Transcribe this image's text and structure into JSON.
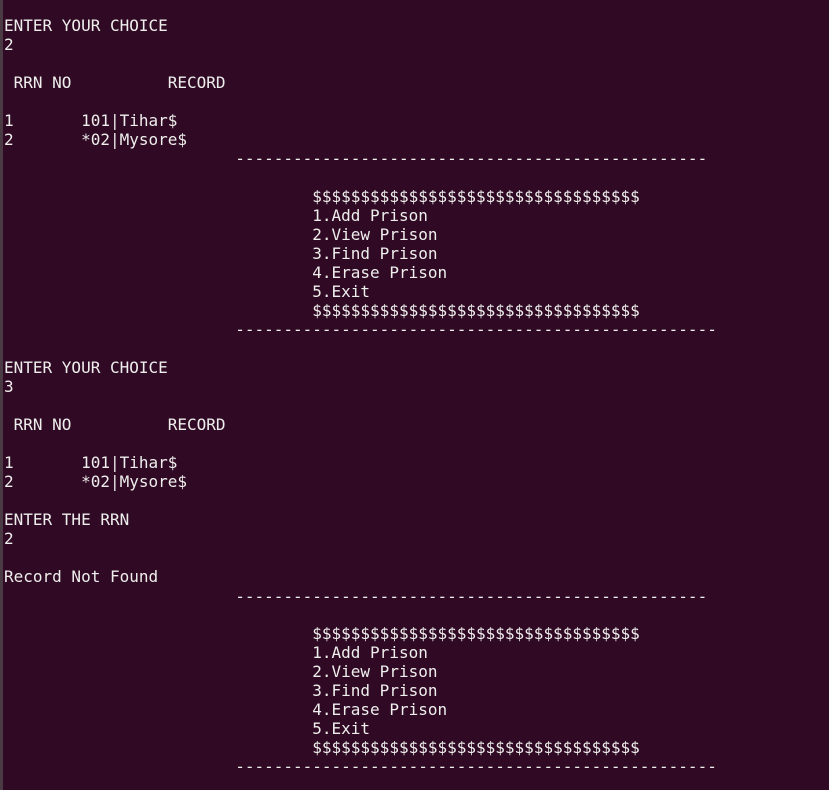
{
  "terminal": {
    "lines": [
      "ENTER YOUR CHOICE",
      "2",
      "",
      " RRN NO          RECORD",
      "",
      "1       101|Tihar$",
      "2       *02|Mysore$",
      "                        -------------------------------------------------",
      "",
      "                                $$$$$$$$$$$$$$$$$$$$$$$$$$$$$$$$$$",
      "                                1.Add Prison",
      "                                2.View Prison",
      "                                3.Find Prison",
      "                                4.Erase Prison",
      "                                5.Exit",
      "                                $$$$$$$$$$$$$$$$$$$$$$$$$$$$$$$$$$",
      "                        --------------------------------------------------",
      "",
      "ENTER YOUR CHOICE",
      "3",
      "",
      " RRN NO          RECORD",
      "",
      "1       101|Tihar$",
      "2       *02|Mysore$",
      "",
      "ENTER THE RRN",
      "2",
      "",
      "Record Not Found",
      "                        -------------------------------------------------",
      "",
      "                                $$$$$$$$$$$$$$$$$$$$$$$$$$$$$$$$$$",
      "                                1.Add Prison",
      "                                2.View Prison",
      "                                3.Find Prison",
      "                                4.Erase Prison",
      "                                5.Exit",
      "                                $$$$$$$$$$$$$$$$$$$$$$$$$$$$$$$$$$",
      "                        --------------------------------------------------"
    ]
  }
}
